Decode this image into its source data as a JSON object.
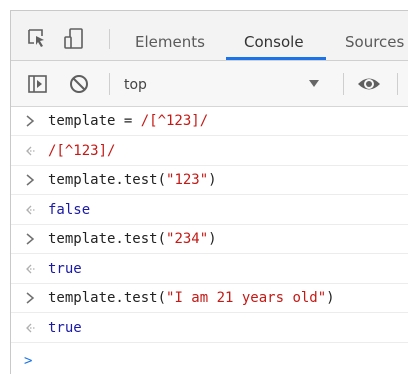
{
  "tabs": [
    {
      "label": "Elements",
      "active": false
    },
    {
      "label": "Console",
      "active": true
    },
    {
      "label": "Sources",
      "active": false
    }
  ],
  "toolbar": {
    "context": "top"
  },
  "console": {
    "lines": [
      {
        "kind": "input",
        "parts": [
          {
            "text": "template = ",
            "style": "text"
          },
          {
            "text": "/[^123]/",
            "style": "regex"
          }
        ]
      },
      {
        "kind": "output",
        "parts": [
          {
            "text": "/[^123]/",
            "style": "regex"
          }
        ]
      },
      {
        "kind": "input",
        "parts": [
          {
            "text": "template.test(",
            "style": "text"
          },
          {
            "text": "\"123\"",
            "style": "str"
          },
          {
            "text": ")",
            "style": "text"
          }
        ]
      },
      {
        "kind": "output",
        "parts": [
          {
            "text": "false",
            "style": "bool"
          }
        ]
      },
      {
        "kind": "input",
        "parts": [
          {
            "text": "template.test(",
            "style": "text"
          },
          {
            "text": "\"234\"",
            "style": "str"
          },
          {
            "text": ")",
            "style": "text"
          }
        ]
      },
      {
        "kind": "output",
        "parts": [
          {
            "text": "true",
            "style": "bool"
          }
        ]
      },
      {
        "kind": "input",
        "parts": [
          {
            "text": "template.test(",
            "style": "text"
          },
          {
            "text": "\"I am 21 years old\"",
            "style": "str"
          },
          {
            "text": ")",
            "style": "text"
          }
        ]
      },
      {
        "kind": "output",
        "parts": [
          {
            "text": "true",
            "style": "bool"
          }
        ]
      }
    ],
    "input_prompt": ">"
  },
  "colors": {
    "accent": "#1a73e8",
    "regex": "#c41a16",
    "boolean": "#1a1aa6"
  }
}
